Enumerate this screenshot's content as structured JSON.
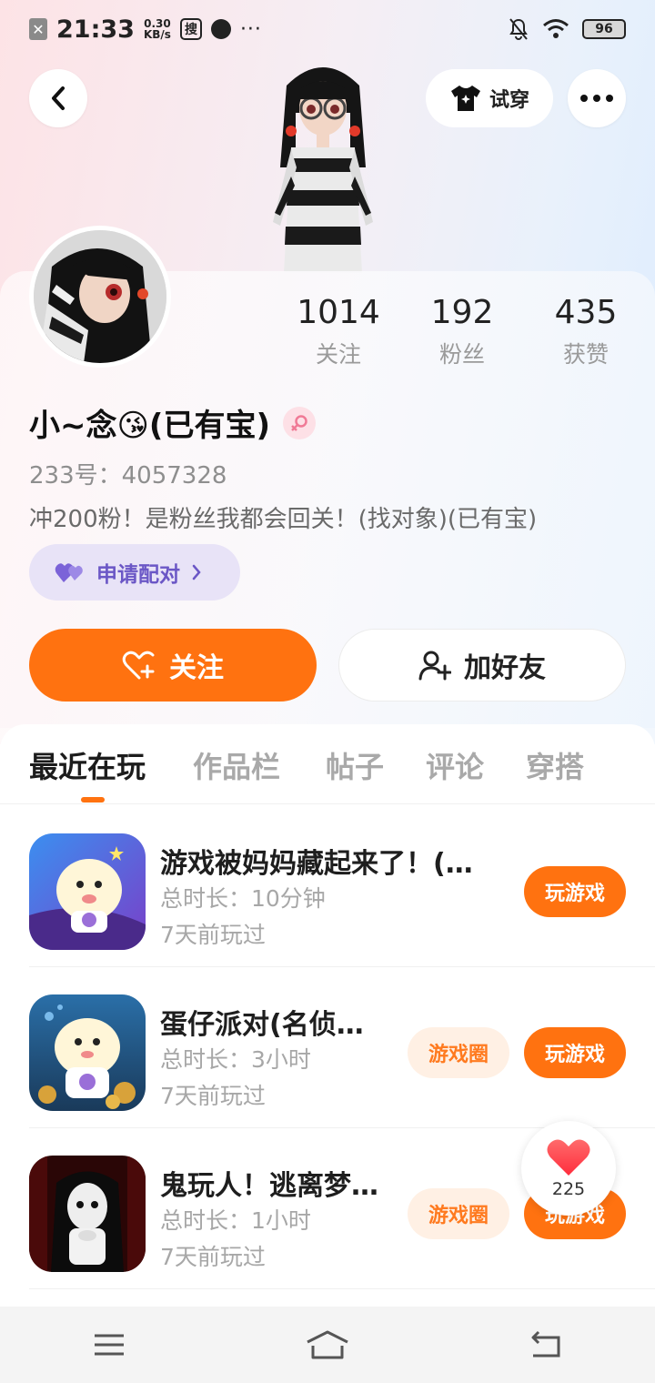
{
  "status_bar": {
    "time": "21:33",
    "speed_value": "0.30",
    "speed_unit": "KB/s",
    "search_glyph": "搜",
    "dots": "···",
    "battery": "96"
  },
  "header": {
    "try_on_label": "试穿"
  },
  "profile": {
    "nickname": "小~念😘(已有宝)",
    "uid": "233号：4057328",
    "bio": "冲200粉！是粉丝我都会回关！(找对象)(已有宝)",
    "pair_label": "申请配对",
    "stats": [
      {
        "num": "1014",
        "label": "关注"
      },
      {
        "num": "192",
        "label": "粉丝"
      },
      {
        "num": "435",
        "label": "获赞"
      }
    ],
    "follow_label": "关注",
    "add_friend_label": "加好友"
  },
  "tabs": [
    {
      "label": "最近在玩",
      "active": true
    },
    {
      "label": "作品栏",
      "active": false
    },
    {
      "label": "帖子",
      "active": false
    },
    {
      "label": "评论",
      "active": false
    },
    {
      "label": "穿搭",
      "active": false
    }
  ],
  "games": [
    {
      "title": "游戏被妈妈藏起来了！(…",
      "duration": "总时长：10分钟",
      "last_played": "7天前玩过",
      "play_label": "玩游戏",
      "circle_label": ""
    },
    {
      "title": "蛋仔派对(名侦…",
      "duration": "总时长：3小时",
      "last_played": "7天前玩过",
      "play_label": "玩游戏",
      "circle_label": "游戏圈"
    },
    {
      "title": "鬼玩人！逃离梦…",
      "duration": "总时长：1小时",
      "last_played": "7天前玩过",
      "play_label": "玩游戏",
      "circle_label": "游戏圈"
    }
  ],
  "floating_like": {
    "count": "225"
  },
  "colors": {
    "accent": "#ff7210",
    "pair_bg": "#e8e3f7",
    "pair_text": "#6b57c6",
    "circle_bg": "#fff0e4"
  }
}
